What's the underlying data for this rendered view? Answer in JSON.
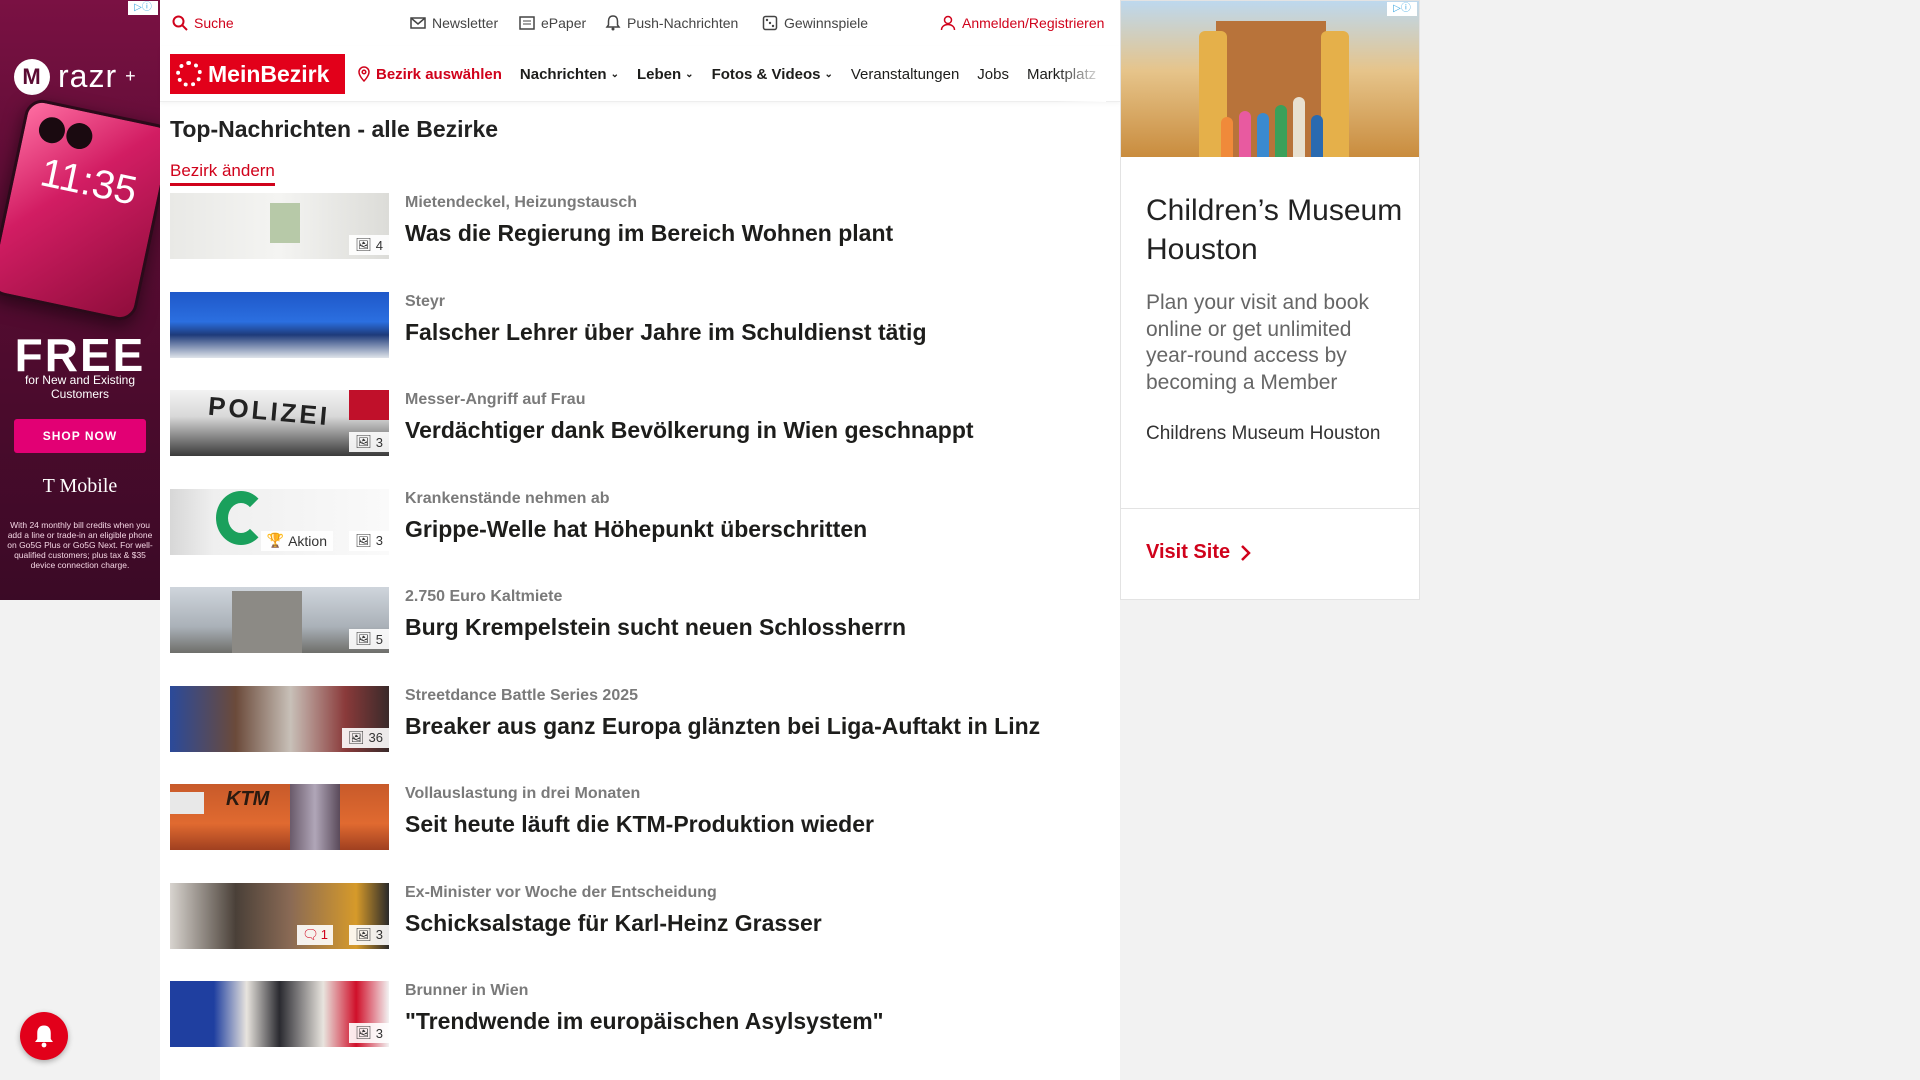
{
  "left_ad": {
    "adchoices": "▷ⓘ",
    "brand": "razr",
    "brand_plus": "+",
    "clock": "11:35",
    "headline": "FREE",
    "subline": "for New and Existing Customers",
    "cta": "SHOP NOW",
    "advertiser": "T Mobile",
    "fine_print": "With 24 monthly bill credits when you add a line or trade-in an eligible phone on Go5G Plus or Go5G Next. For well-qualified customers; plus tax & $35 device connection charge."
  },
  "topbar": {
    "search": "Suche",
    "newsletter": "Newsletter",
    "epaper": "ePaper",
    "push": "Push-Nachrichten",
    "gewinnspiele": "Gewinnspiele",
    "login": "Anmelden/Registrieren"
  },
  "nav": {
    "logo": "MeinBezirk",
    "bezirk": "Bezirk auswählen",
    "nachrichten": "Nachrichten",
    "leben": "Leben",
    "fotos": "Fotos & Videos",
    "veranstaltungen": "Veranstaltungen",
    "jobs": "Jobs",
    "marktplatz": "Marktplatz"
  },
  "page": {
    "heading": "Top-Nachrichten - alle Bezirke",
    "change_link": "Bezirk ändern"
  },
  "articles": [
    {
      "kicker": "Mietendeckel, Heizungstausch",
      "title": "Was die Regierung im Bereich Wohnen plant",
      "photos": "4"
    },
    {
      "kicker": "Steyr",
      "title": "Falscher Lehrer über Jahre im Schuldienst tätig",
      "photos": ""
    },
    {
      "kicker": "Messer-Angriff auf Frau",
      "title": "Verdächtiger dank Bevölkerung in Wien geschnappt",
      "photos": "3"
    },
    {
      "kicker": "Krankenstände nehmen ab",
      "title": "Grippe-Welle hat Höhepunkt überschritten",
      "photos": "3",
      "aktion": "Aktion"
    },
    {
      "kicker": "2.750 Euro Kaltmiete",
      "title": "Burg Krempelstein sucht neuen Schlossherrn",
      "photos": "5"
    },
    {
      "kicker": "Streetdance Battle Series 2025",
      "title": "Breaker aus ganz Europa glänzten bei Liga-Auftakt in Linz",
      "photos": "36"
    },
    {
      "kicker": "Vollauslastung in drei Monaten",
      "title": "Seit heute läuft die KTM-Produktion wieder",
      "photos": ""
    },
    {
      "kicker": "Ex-Minister vor Woche der Entscheidung",
      "title": "Schicksalstage für Karl-Heinz Grasser",
      "photos": "3",
      "comments": "1"
    },
    {
      "kicker": "Brunner in Wien",
      "title": "\"Trendwende im europäischen Asylsystem\"",
      "photos": "3"
    }
  ],
  "thumb_labels": {
    "ktm": "KTM",
    "polizei": "POLIZEI"
  },
  "right_ad": {
    "adchoices": "▷ⓘ",
    "headline": "Children’s Museum Houston",
    "description": "Plan your visit and book online or get unlimited year-round access by becoming a Member",
    "advertiser": "Childrens Museum Houston",
    "cta": "Visit Site"
  },
  "colors": {
    "brand_red": "#e2001a",
    "ad_magenta": "#e20074"
  }
}
